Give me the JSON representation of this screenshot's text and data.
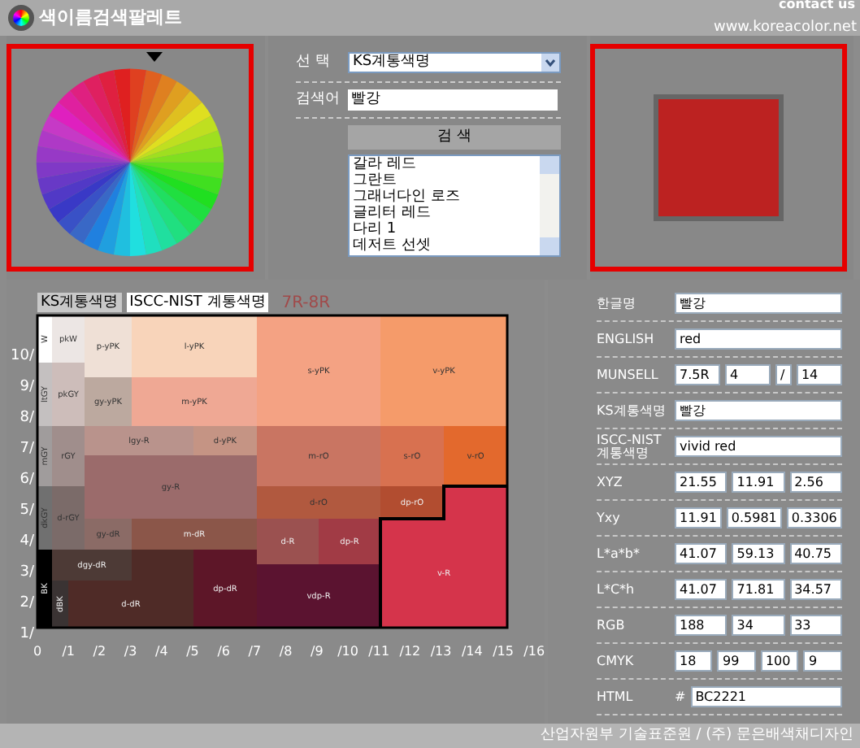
{
  "header": {
    "title": "색이름검색팔레트",
    "contact": "contact us",
    "site": "www.koreacolor.net"
  },
  "search": {
    "select_label": "선 택",
    "select_value": "KS계통색명",
    "keyword_label": "검색어",
    "keyword_value": "빨강",
    "button": "검 색",
    "results": [
      "갈라 레드",
      "그란트",
      "그래너다인 로즈",
      "글리터 레드",
      "다리 1",
      "데저트 선셋"
    ]
  },
  "swatch": {
    "color": "#bc2221"
  },
  "chart": {
    "tabs": [
      {
        "label": "KS계통색명",
        "selected": false
      },
      {
        "label": "ISCC-NIST 계통색명",
        "selected": true
      }
    ],
    "range": "7R-8R",
    "yticks": [
      "10/",
      "9/",
      "8/",
      "7/",
      "6/",
      "5/",
      "4/",
      "3/",
      "2/",
      "1/"
    ],
    "xticks": [
      "0",
      "/1",
      "/2",
      "/3",
      "/4",
      "/5",
      "/6",
      "/7",
      "/8",
      "/9",
      "/10",
      "/11",
      "/12",
      "/13",
      "/14",
      "/15",
      "/16"
    ],
    "blocks": [
      {
        "label": "W",
        "color": "#ffffff"
      },
      {
        "label": "pkW",
        "color": "#ece6e4"
      },
      {
        "label": "p-yPK",
        "color": "#efe0d6"
      },
      {
        "label": "l-yPK",
        "color": "#f8d4ba"
      },
      {
        "label": "s-yPK",
        "color": "#f4a283"
      },
      {
        "label": "v-yPK",
        "color": "#f59b6a"
      },
      {
        "label": "ltGY",
        "color": "#c4c0c0"
      },
      {
        "label": "pkGY",
        "color": "#cdbdba"
      },
      {
        "label": "gy-yPK",
        "color": "#bca99f"
      },
      {
        "label": "m-yPK",
        "color": "#efa894"
      },
      {
        "label": "mGY",
        "color": "#a09c9c"
      },
      {
        "label": "rGY",
        "color": "#a08e8c"
      },
      {
        "label": "lgy-R",
        "color": "#b9938c"
      },
      {
        "label": "d-yPK",
        "color": "#c59484"
      },
      {
        "label": "m-rO",
        "color": "#c97562"
      },
      {
        "label": "s-rO",
        "color": "#d87150"
      },
      {
        "label": "v-rO",
        "color": "#e3692d"
      },
      {
        "label": "gy-R",
        "color": "#9b6b6b"
      },
      {
        "label": "dkGY",
        "color": "#707070"
      },
      {
        "label": "d-rGY",
        "color": "#7b6b69"
      },
      {
        "label": "d-rO",
        "color": "#b1593f"
      },
      {
        "label": "dp-rO",
        "color": "#b24d30"
      },
      {
        "label": "gy-dR",
        "color": "#8b6b66"
      },
      {
        "label": "m-dR",
        "color": "#8b5649"
      },
      {
        "label": "d-R",
        "color": "#9b5150"
      },
      {
        "label": "dp-R",
        "color": "#a13b45"
      },
      {
        "label": "dgy-dR",
        "color": "#4d3a36"
      },
      {
        "label": "v-R",
        "color": "#d5344b"
      },
      {
        "label": "BK",
        "color": "#000000"
      },
      {
        "label": "dp-dR",
        "color": "#5d1628"
      },
      {
        "label": "vdp-R",
        "color": "#5b1330"
      },
      {
        "label": "dBK",
        "color": "#3a3333"
      },
      {
        "label": "d-dR",
        "color": "#4f2b27"
      }
    ]
  },
  "info": [
    {
      "label": "한글명",
      "values": [
        "빨강"
      ]
    },
    {
      "label": "ENGLISH",
      "values": [
        "red"
      ]
    },
    {
      "label": "MUNSELL",
      "values": [
        "7.5R",
        "4",
        "/",
        "14"
      ]
    },
    {
      "label": "KS계통색명",
      "values": [
        "빨강"
      ]
    },
    {
      "label": "ISCC-NIST 계통색명",
      "values": [
        "vivid red"
      ]
    },
    {
      "label": "XYZ",
      "values": [
        "21.55",
        "11.91",
        "2.56"
      ]
    },
    {
      "label": "Yxy",
      "values": [
        "11.91",
        "0.5981",
        "0.3306"
      ]
    },
    {
      "label": "L*a*b*",
      "values": [
        "41.07",
        "59.13",
        "40.75"
      ]
    },
    {
      "label": "L*C*h",
      "values": [
        "41.07",
        "71.81",
        "34.57"
      ]
    },
    {
      "label": "RGB",
      "values": [
        "188",
        "34",
        "33"
      ]
    },
    {
      "label": "CMYK",
      "values": [
        "18",
        "99",
        "100",
        "9"
      ]
    },
    {
      "label": "HTML",
      "prefix": "#",
      "values": [
        "BC2221"
      ]
    }
  ],
  "footer": "산업자원부 기술표준원 / (주) 문은배색채디자인"
}
